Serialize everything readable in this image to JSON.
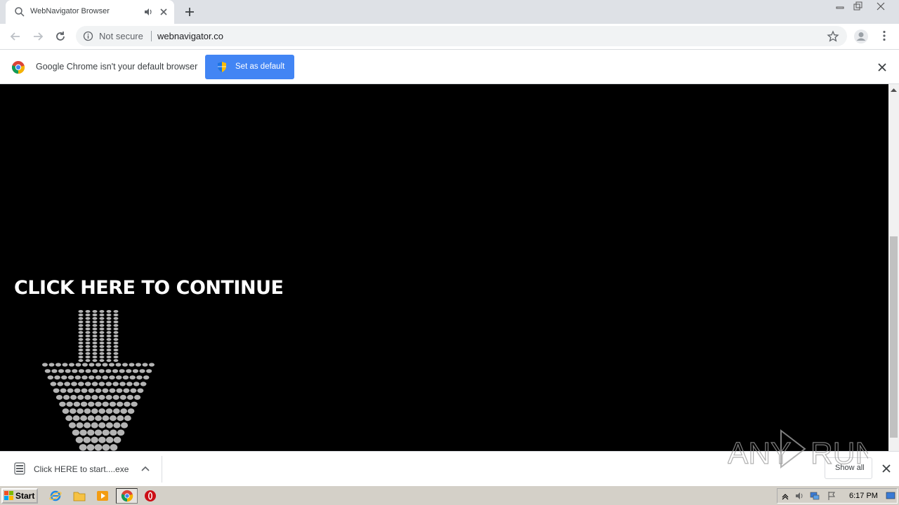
{
  "tab": {
    "title": "WebNavigator Browser"
  },
  "omnibox": {
    "security_label": "Not secure",
    "url": "webnavigator.co"
  },
  "infobar": {
    "message": "Google Chrome isn't your default browser",
    "button_label": "Set as default"
  },
  "content": {
    "cta_text": "CLICK HERE TO CONTINUE"
  },
  "download": {
    "filename": "Click HERE to start....exe",
    "show_all_label": "Show all"
  },
  "watermark": {
    "text": "ANY RUN"
  },
  "taskbar": {
    "start_label": "Start",
    "clock": "6:17 PM"
  },
  "colors": {
    "accent": "#4285f4",
    "content_bg": "#000000",
    "arrow_dots": "#b4b4b4",
    "taskbar": "#d4d0c8"
  },
  "icons": [
    "search-icon",
    "speaker-icon",
    "close-icon",
    "plus-icon",
    "back-arrow-icon",
    "forward-arrow-icon",
    "reload-icon",
    "info-icon",
    "star-icon",
    "profile-icon",
    "more-vert-icon",
    "chrome-logo-icon",
    "shield-icon",
    "file-icon",
    "chevron-up-icon"
  ]
}
